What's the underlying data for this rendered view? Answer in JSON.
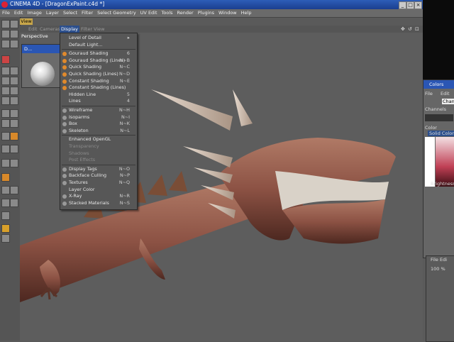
{
  "window": {
    "title": "CINEMA 4D - [DragonExPaint.c4d *]"
  },
  "menubar": [
    "File",
    "Edit",
    "Image",
    "Layer",
    "Select",
    "Filter",
    "Select Geometry",
    "UV Edit",
    "Tools",
    "Render",
    "Plugins",
    "Window",
    "Help"
  ],
  "view": {
    "tab": "View",
    "menu": [
      "Edit",
      "Cameras",
      "Display",
      "Filter",
      "View"
    ],
    "active_menu": "Display",
    "viewport_label": "Perspective"
  },
  "material": {
    "title": "D..."
  },
  "display_menu": [
    {
      "label": "Level of Detail",
      "shortcut": "▸",
      "icon": "none",
      "disabled": false
    },
    {
      "label": "Default Light...",
      "shortcut": "",
      "icon": "none",
      "disabled": false
    },
    {
      "label": "Gouraud Shading",
      "shortcut": "6",
      "icon": "orange",
      "disabled": false
    },
    {
      "label": "Gouraud Shading (Lines)",
      "shortcut": "N~B",
      "icon": "orange",
      "disabled": false
    },
    {
      "label": "Quick Shading",
      "shortcut": "N~C",
      "icon": "orange",
      "disabled": false
    },
    {
      "label": "Quick Shading (Lines)",
      "shortcut": "N~D",
      "icon": "orange",
      "disabled": false
    },
    {
      "label": "Constant Shading",
      "shortcut": "N~E",
      "icon": "orange",
      "disabled": false
    },
    {
      "label": "Constant Shading (Lines)",
      "shortcut": "",
      "icon": "orange",
      "disabled": false
    },
    {
      "label": "Hidden Line",
      "shortcut": "5",
      "icon": "none",
      "disabled": false
    },
    {
      "label": "Lines",
      "shortcut": "4",
      "icon": "none",
      "disabled": false
    },
    {
      "label": "Wireframe",
      "shortcut": "N~H",
      "icon": "gray",
      "disabled": false
    },
    {
      "label": "Isoparms",
      "shortcut": "N~I",
      "icon": "gray",
      "disabled": false
    },
    {
      "label": "Box",
      "shortcut": "N~K",
      "icon": "gray",
      "disabled": false
    },
    {
      "label": "Skeleton",
      "shortcut": "N~L",
      "icon": "gray",
      "disabled": false
    },
    {
      "label": "Enhanced OpenGL",
      "shortcut": "",
      "icon": "none",
      "disabled": false
    },
    {
      "label": "Transparency",
      "shortcut": "",
      "icon": "none",
      "disabled": true
    },
    {
      "label": "Shadows",
      "shortcut": "",
      "icon": "none",
      "disabled": true
    },
    {
      "label": "Post Effects",
      "shortcut": "",
      "icon": "none",
      "disabled": true
    },
    {
      "label": "Display Tags",
      "shortcut": "N~O",
      "icon": "gray",
      "disabled": false
    },
    {
      "label": "Backface Culling",
      "shortcut": "N~P",
      "icon": "gray",
      "disabled": false
    },
    {
      "label": "Textures",
      "shortcut": "N~Q",
      "icon": "gray",
      "disabled": false
    },
    {
      "label": "Layer Color",
      "shortcut": "",
      "icon": "none",
      "disabled": false
    },
    {
      "label": "X-Ray",
      "shortcut": "N~R",
      "icon": "gray",
      "disabled": false
    },
    {
      "label": "Stacked Materials",
      "shortcut": "N~S",
      "icon": "gray",
      "disabled": false
    }
  ],
  "colors_panel": {
    "title": "Colors",
    "menu": [
      "File",
      "Edit"
    ],
    "channel_field": "Channe",
    "channels_label": "Channels",
    "color_label": "Color",
    "solid_color": "Solid Color",
    "brightness_label": "Brightness"
  },
  "attr_panel": {
    "menu": [
      "File",
      "Edi"
    ],
    "zoom": "100 %"
  },
  "colors": {
    "accent": "#2a56b4",
    "menu_active": "#2c4f8c",
    "tab": "#c8a64a",
    "dragon": "#8c5244"
  }
}
